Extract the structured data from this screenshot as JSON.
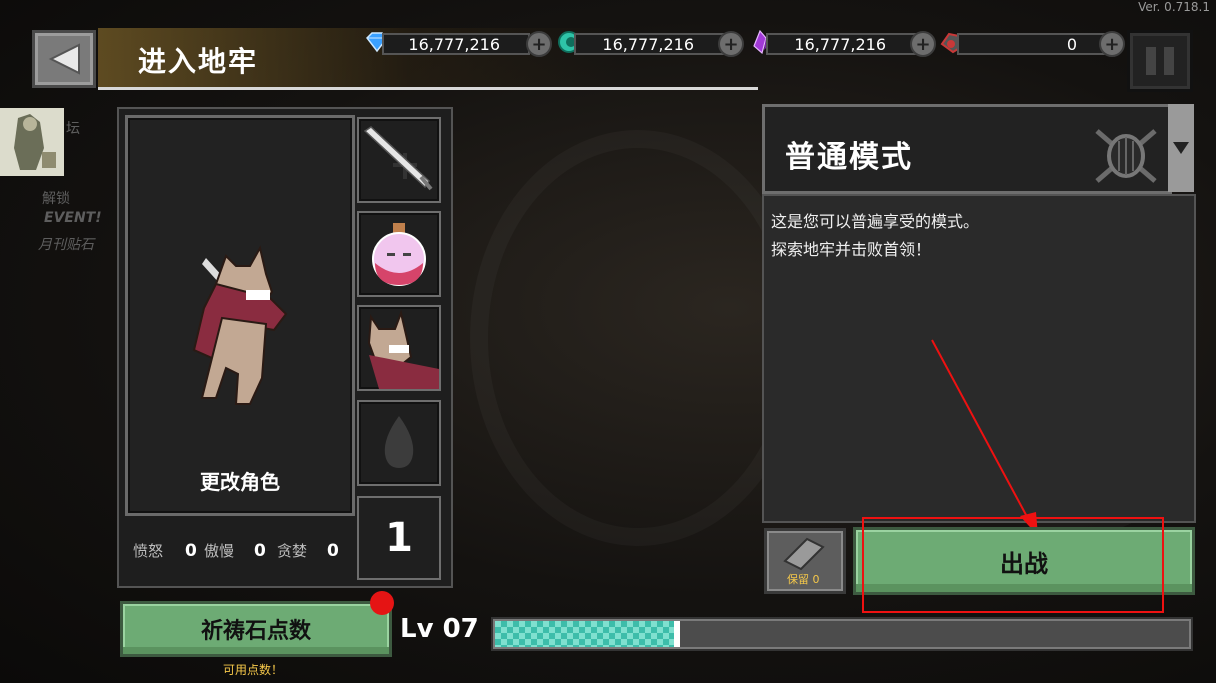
{
  "version": "Ver. 0.718.1",
  "header": {
    "title": "进入地牢"
  },
  "currencies": [
    {
      "name": "diamond",
      "icon": "diamond-icon",
      "value": "16,777,216",
      "color": "#3aa0ff"
    },
    {
      "name": "teal-gem",
      "icon": "teal-gem-icon",
      "value": "16,777,216",
      "color": "#2ec4a8"
    },
    {
      "name": "crystal",
      "icon": "purple-crystal-icon",
      "value": "16,777,216",
      "color": "#a13ad6"
    },
    {
      "name": "ore",
      "icon": "red-ore-icon",
      "value": "0",
      "color": "#c83838"
    }
  ],
  "side_menu": {
    "items": [
      "坛",
      "解锁",
      "EVENT!",
      "月刊贴石"
    ]
  },
  "character": {
    "change_label": "更改角色"
  },
  "stats": [
    {
      "label": "愤怒",
      "value": "0"
    },
    {
      "label": "傲慢",
      "value": "0"
    },
    {
      "label": "贪婪",
      "value": "0"
    }
  ],
  "equipment_slots": [
    "sword-icon",
    "potion-icon",
    "character-portrait-icon",
    "flame-icon"
  ],
  "count": "1",
  "mode": {
    "name": "普通模式",
    "description": [
      "这是您可以普遍享受的模式。",
      "探索地牢并击败首领！"
    ]
  },
  "keep": {
    "label": "保留",
    "value": "0"
  },
  "go_button": "出战",
  "prayer_button": "祈祷石点数",
  "available_points": "可用点数！",
  "level": {
    "label": "Lv 07",
    "progress": 0.26
  }
}
